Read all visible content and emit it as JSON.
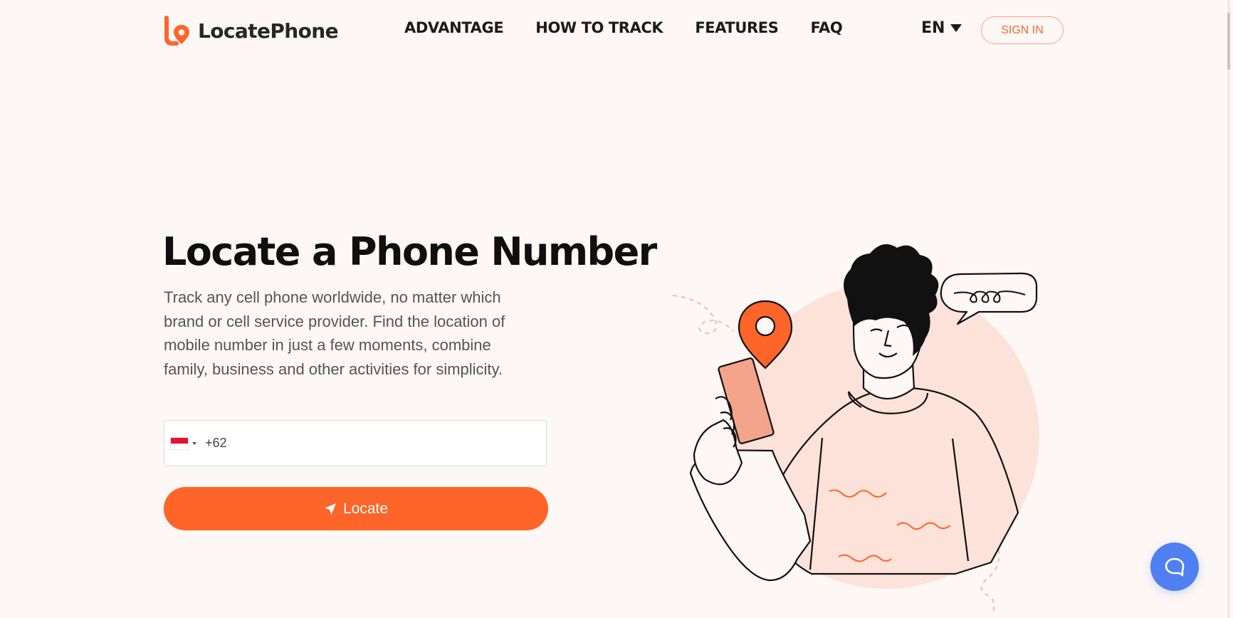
{
  "brand": {
    "name": "LocatePhone",
    "logo_icon": "locate-pin-logo-icon",
    "accent": "#ff6428"
  },
  "nav": {
    "items": [
      "ADVANTAGE",
      "HOW TO TRACK",
      "FEATURES",
      "FAQ"
    ]
  },
  "language": {
    "selected": "EN",
    "icon": "caret-down-icon"
  },
  "header": {
    "signin_label": "SIGN IN"
  },
  "hero": {
    "title": "Locate a Phone Number",
    "description": "Track any cell phone worldwide, no matter which brand or cell service provider. Find the location of mobile number in just a few moments, combine family, business and other activities for simplicity.",
    "phone_input": {
      "country_flag": "indonesia-flag-icon",
      "value": "+62"
    },
    "locate_button": {
      "label": "Locate",
      "icon": "navigation-arrow-icon"
    }
  },
  "illustration": {
    "name": "person-with-phone-illustration"
  },
  "support_chat": {
    "icon": "chat-bubble-icon",
    "color": "#4f7ff0"
  }
}
